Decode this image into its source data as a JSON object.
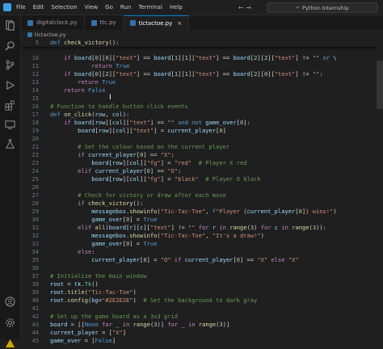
{
  "titlebar": {
    "menus": [
      "File",
      "Edit",
      "Selection",
      "View",
      "Go",
      "Run",
      "Terminal",
      "Help"
    ],
    "search": "Python Internship"
  },
  "tabs": [
    {
      "label": "digitalclock.py",
      "active": false
    },
    {
      "label": "ttc.py",
      "active": false
    },
    {
      "label": "tictactoe.py",
      "active": true,
      "close": "×"
    }
  ],
  "breadcrumb": "tictactoe.py",
  "sticky_line": {
    "num": "5",
    "text": "def check_victory():"
  },
  "lines": [
    {
      "num": "11",
      "html": "            <span class=\"kw\">return</span> <span class=\"bl\">True</span>"
    },
    {
      "num": "12",
      "html": "    <span class=\"kw\">if</span> <span class=\"var\">board</span>[<span class=\"num\">0</span>][<span class=\"num\">2</span>][<span class=\"str\">\"text\"</span>] == <span class=\"var\">board</span>[<span class=\"num\">1</span>][<span class=\"num\">1</span>][<span class=\"str\">\"text\"</span>] == <span class=\"var\">board</span>[<span class=\"num\">2</span>][<span class=\"num\">0</span>][<span class=\"str\">\"text\"</span>] != <span class=\"str\">\"\"</span>:"
    },
    {
      "num": "13",
      "html": "        <span class=\"kw\">return</span> <span class=\"bl\">True</span>"
    },
    {
      "num": "14",
      "html": "    <span class=\"kw\">return</span> <span class=\"bl\">False</span>"
    },
    {
      "num": "15",
      "html": ""
    },
    {
      "num": "16",
      "html": "<span class=\"cm\"># Function to handle button click events</span>"
    },
    {
      "num": "17",
      "html": "<span class=\"bl\">def</span> <span class=\"fn\">on_click</span>(<span class=\"var\">row</span>, <span class=\"var\">col</span>):"
    },
    {
      "num": "18",
      "html": "    <span class=\"kw\">if</span> <span class=\"var\">board</span>[<span class=\"var\">row</span>][<span class=\"var\">col</span>][<span class=\"str\">\"text\"</span>] == <span class=\"str\">\"\"</span> <span class=\"bl\">and not</span> <span class=\"var\">game_over</span>[<span class=\"num\">0</span>]:"
    },
    {
      "num": "19",
      "html": "        <span class=\"var\">board</span>[<span class=\"var\">row</span>][<span class=\"var\">col</span>][<span class=\"str\">\"text\"</span>] = <span class=\"var\">current_player</span>[<span class=\"num\">0</span>]"
    },
    {
      "num": "20",
      "html": ""
    },
    {
      "num": "21",
      "html": "        <span class=\"cm\"># Set the colour based on the current player</span>"
    },
    {
      "num": "22",
      "html": "        <span class=\"kw\">if</span> <span class=\"var\">current_player</span>[<span class=\"num\">0</span>] == <span class=\"str\">\"X\"</span>:"
    },
    {
      "num": "23",
      "html": "            <span class=\"var\">board</span>[<span class=\"var\">row</span>][<span class=\"var\">col</span>][<span class=\"str\">\"fg\"</span>] = <span class=\"str\">\"red\"</span>  <span class=\"cm\"># Player X red</span>"
    },
    {
      "num": "24",
      "html": "        <span class=\"kw\">elif</span> <span class=\"var\">current_player</span>[<span class=\"num\">0</span>] == <span class=\"str\">\"O\"</span>:"
    },
    {
      "num": "25",
      "html": "            <span class=\"var\">board</span>[<span class=\"var\">row</span>][<span class=\"var\">col</span>][<span class=\"str\">\"fg\"</span>] = <span class=\"str\">\"black\"</span>  <span class=\"cm\"># Player O black</span>"
    },
    {
      "num": "26",
      "html": ""
    },
    {
      "num": "27",
      "html": "        <span class=\"cm\"># Check for victory or draw after each move</span>"
    },
    {
      "num": "28",
      "html": "        <span class=\"kw\">if</span> <span class=\"fn\">check_victory</span>():"
    },
    {
      "num": "29",
      "html": "            <span class=\"var\">messagebox</span>.<span class=\"fn\">showinfo</span>(<span class=\"str\">\"Tic-Tac-Toe\"</span>, <span class=\"bl\">f</span><span class=\"str\">\"Player {</span><span class=\"var\">current_player</span>[<span class=\"num\">0</span>]<span class=\"str\">} wins!\"</span>)"
    },
    {
      "num": "30",
      "html": "            <span class=\"var\">game_over</span>[<span class=\"num\">0</span>] = <span class=\"bl\">True</span>"
    },
    {
      "num": "31",
      "html": "        <span class=\"kw\">elif</span> <span class=\"fn\">all</span>(<span class=\"var\">board</span>[<span class=\"var\">r</span>][<span class=\"var\">c</span>][<span class=\"str\">\"text\"</span>] != <span class=\"str\">\"\"</span> <span class=\"kw\">for</span> <span class=\"var\">r</span> <span class=\"kw\">in</span> <span class=\"fn\">range</span>(<span class=\"num\">3</span>) <span class=\"kw\">for</span> <span class=\"var\">c</span> <span class=\"kw\">in</span> <span class=\"fn\">range</span>(<span class=\"num\">3</span>)):"
    },
    {
      "num": "32",
      "html": "            <span class=\"var\">messagebox</span>.<span class=\"fn\">showinfo</span>(<span class=\"str\">\"Tic-Tac-Toe\"</span>, <span class=\"str\">\"It's a draw!\"</span>)"
    },
    {
      "num": "33",
      "html": "            <span class=\"var\">game_over</span>[<span class=\"num\">0</span>] = <span class=\"bl\">True</span>"
    },
    {
      "num": "34",
      "html": "        <span class=\"kw\">else</span>:"
    },
    {
      "num": "35",
      "html": "            <span class=\"var\">current_player</span>[<span class=\"num\">0</span>] = <span class=\"str\">\"O\"</span> <span class=\"kw\">if</span> <span class=\"var\">current_player</span>[<span class=\"num\">0</span>] == <span class=\"str\">\"X\"</span> <span class=\"kw\">else</span> <span class=\"str\">\"X\"</span>"
    },
    {
      "num": "36",
      "html": ""
    },
    {
      "num": "37",
      "html": "<span class=\"cm\"># Initialize the main window</span>"
    },
    {
      "num": "38",
      "html": "<span class=\"var\">root</span> = <span class=\"var\">tk</span>.<span class=\"cls\">Tk</span>()"
    },
    {
      "num": "39",
      "html": "<span class=\"var\">root</span>.<span class=\"fn\">title</span>(<span class=\"str\">\"Tic-Tac-Toe\"</span>)"
    },
    {
      "num": "40",
      "html": "<span class=\"var\">root</span>.<span class=\"fn\">config</span>(<span class=\"var\">bg</span>=<span class=\"str\">\"#2E2E2E\"</span>)  <span class=\"cm\"># Set the background to dark gray</span>"
    },
    {
      "num": "41",
      "html": ""
    },
    {
      "num": "42",
      "html": "<span class=\"cm\"># Set up the game board as a 3x3 grid</span>"
    },
    {
      "num": "43",
      "html": "<span class=\"var\">board</span> = [[<span class=\"bl\">None</span> <span class=\"kw\">for</span> <span class=\"var\">_</span> <span class=\"kw\">in</span> <span class=\"fn\">range</span>(<span class=\"num\">3</span>)] <span class=\"kw\">for</span> <span class=\"var\">_</span> <span class=\"kw\">in</span> <span class=\"fn\">range</span>(<span class=\"num\">3</span>)]"
    },
    {
      "num": "44",
      "html": "<span class=\"var\">current_player</span> = [<span class=\"str\">\"X\"</span>]"
    },
    {
      "num": "45",
      "html": "<span class=\"var\">game_over</span> = [<span class=\"bl\">False</span>]"
    }
  ],
  "partial_line": {
    "html": "    <span class=\"kw\">if</span> <span class=\"var\">board</span>[<span class=\"num\">0</span>][<span class=\"num\">0</span>][<span class=\"str\">\"text\"</span>] == <span class=\"var\">board</span>[<span class=\"num\">1</span>][<span class=\"num\">1</span>][<span class=\"str\">\"text\"</span>] == <span class=\"var\">board</span>[<span class=\"num\">2</span>][<span class=\"num\">2</span>][<span class=\"str\">\"text\"</span>] != <span class=\"str\">\"\"</span> <span class=\"bl\">or</span> \\"
  }
}
